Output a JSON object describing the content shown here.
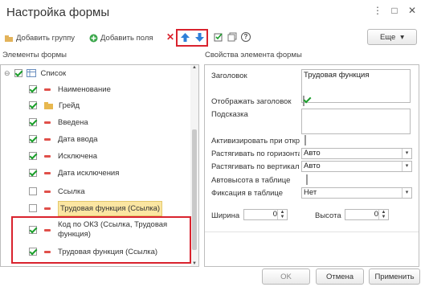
{
  "window": {
    "title": "Настройка формы",
    "menu_glyph": "⋮",
    "maximize_glyph": "□",
    "close_glyph": "✕"
  },
  "toolbar": {
    "add_group": "Добавить группу",
    "add_fields": "Добавить поля",
    "delete_glyph": "✕",
    "up_arrow": "🡅",
    "down_arrow": "🡇",
    "help_glyph": "?",
    "more_label": "Еще",
    "more_arrow": "▾"
  },
  "left_panel": {
    "title": "Элементы формы",
    "root": {
      "label": "Список",
      "expander": "⊖"
    },
    "items": [
      {
        "label": "Наименование",
        "checked": true,
        "icon": "field-dash-icon"
      },
      {
        "label": "Грейд",
        "checked": true,
        "icon": "folder-icon"
      },
      {
        "label": "Введена",
        "checked": true,
        "icon": "field-dash-icon"
      },
      {
        "label": "Дата ввода",
        "checked": true,
        "icon": "field-dash-icon"
      },
      {
        "label": "Исключена",
        "checked": true,
        "icon": "field-dash-icon"
      },
      {
        "label": "Дата исключения",
        "checked": true,
        "icon": "field-dash-icon"
      },
      {
        "label": "Ссылка",
        "checked": false,
        "icon": "field-dash-icon"
      },
      {
        "label": "Трудовая функция (Ссылка)",
        "checked": false,
        "icon": "field-dash-icon",
        "highlighted": true
      },
      {
        "label": "Код по ОКЗ (Ссылка, Трудовая функция)",
        "checked": true,
        "icon": "field-dash-icon"
      },
      {
        "label": "Трудовая функция (Ссылка)",
        "checked": true,
        "icon": "field-dash-icon"
      }
    ]
  },
  "right_panel": {
    "title": "Свойства элемента формы",
    "header_label": "Заголовок",
    "header_value": "Трудовая функция",
    "show_header_label": "Отображать заголовок",
    "show_header_checked": true,
    "hint_label": "Подсказка",
    "activate_label": "Активизировать при открытии",
    "activate_checked": false,
    "stretch_h_label": "Растягивать по горизонтали",
    "stretch_h_value": "Авто",
    "stretch_v_label": "Растягивать по вертикали",
    "stretch_v_value": "Авто",
    "autoheight_label": "Автовысота в таблице",
    "autoheight_checked": false,
    "fix_label": "Фиксация в таблице",
    "fix_value": "Нет",
    "width_label": "Ширина",
    "width_value": "0",
    "height_label": "Высота",
    "height_value": "0",
    "dropdown_arrow": "▾"
  },
  "footer": {
    "ok": "OK",
    "cancel": "Отмена",
    "apply": "Применить"
  },
  "colors": {
    "highlight": "#fbe6a2",
    "accent_red": "#d9232e",
    "check_green": "#1a9e2a",
    "arrow_blue": "#2f7fd8"
  }
}
